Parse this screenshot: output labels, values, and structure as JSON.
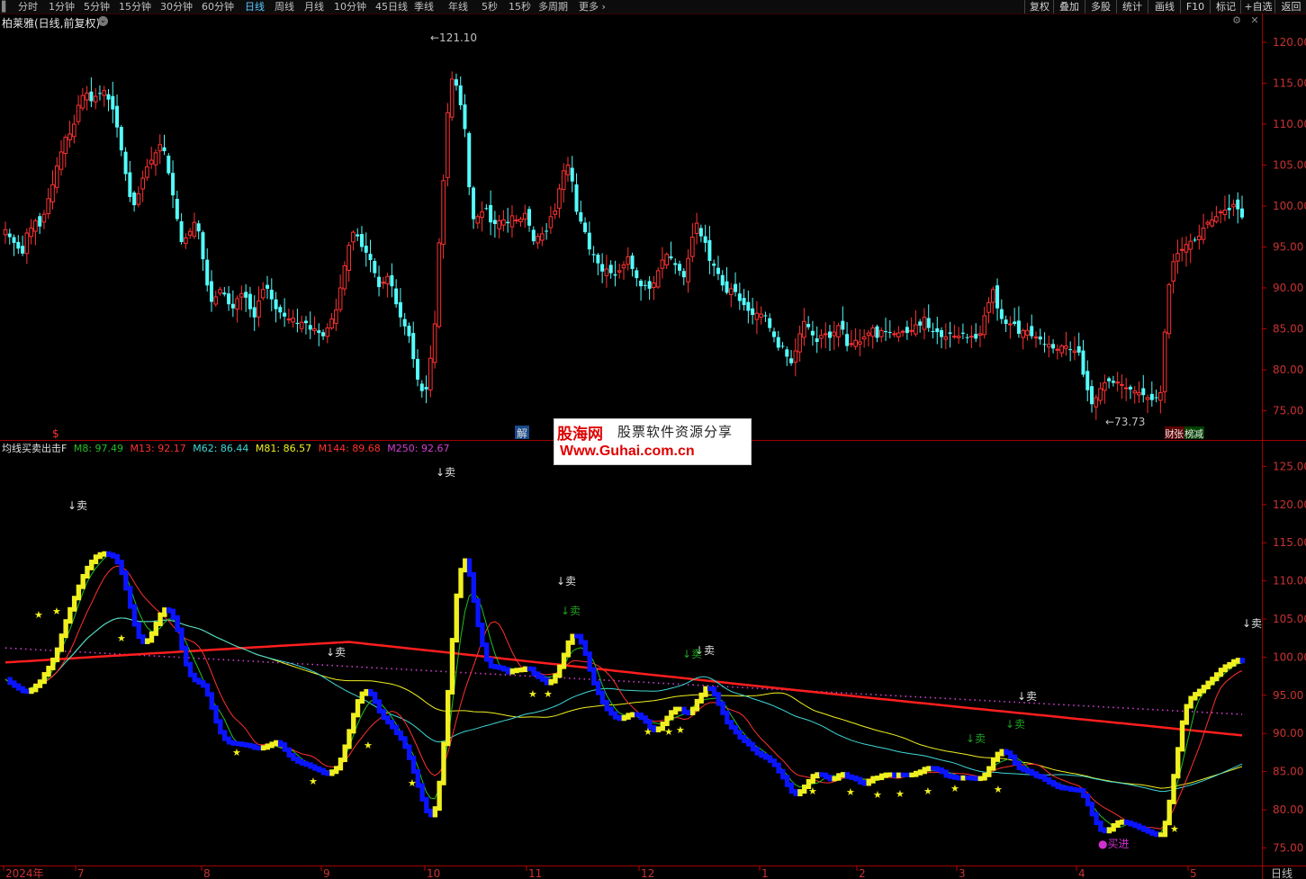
{
  "toolbar": {
    "periods": [
      "分时",
      "1分钟",
      "5分钟",
      "15分钟",
      "30分钟",
      "60分钟",
      "日线",
      "周线",
      "月线",
      "10分钟",
      "45日线",
      "季线",
      "年线",
      "5秒",
      "15秒",
      "多周期",
      "更多"
    ],
    "active": "日线",
    "right_buttons": [
      "复权",
      "叠加",
      "多股",
      "统计",
      "画线",
      "F10",
      "标记",
      "+自选",
      "返回"
    ]
  },
  "stock": {
    "title": "柏莱雅(日线,前复权)"
  },
  "watermark": {
    "brand": "股海网",
    "tagline": "股票软件资源分享",
    "url": "Www.Guhai.com.cn"
  },
  "colors": {
    "up": "#ff3232",
    "down": "#54fcfc",
    "bg": "#000000",
    "axis": "#c00000"
  },
  "chart_data": [
    {
      "type": "candlestick",
      "title": "",
      "ylim": [
        73,
        122
      ],
      "y_ticks": [
        75,
        80,
        85,
        90,
        95,
        100,
        105,
        110,
        115,
        120
      ],
      "annotations": {
        "high": "121.10",
        "low": "73.73"
      },
      "markers": {
        "left": "$",
        "mid": "解",
        "right_a": "财",
        "right_b": "张",
        "right_c": "榜",
        "right_d": "减"
      },
      "closes": [
        97.1,
        96.2,
        95.5,
        94.8,
        94.2,
        96.7,
        97.3,
        98.2,
        97.5,
        99,
        100.9,
        102.6,
        104.9,
        106.6,
        108.4,
        108.8,
        110,
        112.3,
        113.5,
        113.8,
        112.8,
        113.4,
        113.8,
        114.1,
        113,
        111.8,
        109.6,
        106.8,
        103.9,
        101.1,
        100.1,
        101.5,
        103.4,
        104.8,
        105.6,
        106.5,
        107.5,
        106.7,
        104,
        101.3,
        98.4,
        95.6,
        96.1,
        96.9,
        98,
        96.9,
        93.5,
        90.3,
        88.3,
        88.9,
        89.8,
        89.2,
        88,
        87.5,
        88.7,
        89.3,
        88.8,
        87.4,
        86.4,
        88.4,
        89.8,
        89.9,
        88.6,
        87.4,
        87,
        86.5,
        86.2,
        86.3,
        85.6,
        85.8,
        85.7,
        84.9,
        85,
        84.5,
        84.1,
        85.1,
        86.2,
        87.3,
        90,
        92.7,
        95.2,
        96.8,
        96.3,
        95,
        94.3,
        93.4,
        91.8,
        90.1,
        90.7,
        91.4,
        90.2,
        88,
        86.4,
        85.3,
        84.1,
        81.3,
        78.8,
        77.4,
        77.6,
        81.4,
        85.6,
        95.5,
        103.1,
        111.4,
        115.5,
        114.7,
        112.3,
        109.4,
        102.3,
        98.4,
        98.7,
        99.3,
        99.7,
        98,
        97.8,
        98.2,
        98.3,
        97.9,
        98.8,
        98.3,
        98.4,
        99.1,
        97.6,
        95.7,
        96.3,
        96.6,
        96.9,
        98.7,
        99.4,
        102.1,
        104.3,
        105,
        103,
        99.3,
        98.1,
        96.8,
        94.7,
        94,
        93,
        92,
        92.3,
        91.8,
        91.5,
        92.1,
        92.8,
        93.8,
        92.3,
        91.2,
        90.2,
        90.3,
        89.9,
        90.6,
        92.1,
        93.4,
        94.1,
        93.6,
        92.8,
        92.1,
        91.3,
        93.6,
        96.2,
        97.9,
        96.3,
        95.5,
        93.3,
        92.7,
        91.7,
        90.3,
        89.4,
        89.9,
        89.5,
        88.4,
        87.9,
        87.2,
        86.7,
        86.9,
        86.8,
        86.6,
        85.1,
        84,
        82.7,
        82.9,
        81.6,
        80.8,
        82.3,
        84.4,
        85.9,
        85.2,
        84.2,
        83.4,
        84.2,
        84.4,
        83.9,
        84.6,
        85.4,
        84.9,
        82.9,
        83.2,
        83.6,
        83.4,
        84,
        84.5,
        85.1,
        83.9,
        84.8,
        84.6,
        84.6,
        84.4,
        84.5,
        84.7,
        84.5,
        84.8,
        85.5,
        85.4,
        86.4,
        85.1,
        84.7,
        84.6,
        84,
        84,
        84.4,
        84.1,
        84.1,
        84.4,
        83.9,
        84.1,
        83.8,
        84.4,
        86.6,
        88.2,
        89.8,
        87.5,
        86.2,
        85.6,
        85.6,
        85.6,
        84.4,
        84.8,
        84.8,
        84.1,
        84,
        83.7,
        83.1,
        83.1,
        82.6,
        82.5,
        82.9,
        82.9,
        82.4,
        82.3,
        82.1,
        79.4,
        77.5,
        75.8,
        76.6,
        77.7,
        78.4,
        78.6,
        78.4,
        78.5,
        78.2,
        77.8,
        77.6,
        77.4,
        77.2,
        76.9,
        76.6,
        76.3,
        76.6,
        77.2,
        84.6,
        90.4,
        93.2,
        94.2,
        94.7,
        95.3,
        95.7,
        95.8,
        96.3,
        97.3,
        98,
        98.3,
        98.7,
        99.3,
        99.5,
        99.5,
        100.2,
        99.6,
        98.6
      ]
    },
    {
      "type": "line",
      "title": "均线买卖出击F",
      "ylim": [
        73,
        128
      ],
      "y_ticks": [
        75,
        80,
        85,
        90,
        95,
        100,
        105,
        110,
        115,
        120,
        125
      ],
      "series": [
        {
          "name": "M8",
          "label": "M8: 97.49",
          "color": "#22c022"
        },
        {
          "name": "M13",
          "label": "M13: 92.17",
          "color": "#ff3030"
        },
        {
          "name": "M62",
          "label": "M62: 86.44",
          "color": "#40d8d8"
        },
        {
          "name": "M81",
          "label": "M81: 86.57",
          "color": "#f0f020"
        },
        {
          "name": "M144",
          "label": "M144: 89.68",
          "color": "#ff2020"
        },
        {
          "name": "M250",
          "label": "M250: 92.67",
          "color": "#d040d0"
        }
      ],
      "signal_labels": {
        "sell": "↓卖",
        "buy": "●买进",
        "star": "★"
      }
    }
  ],
  "x_axis": {
    "labels": [
      "2024年",
      "7",
      "8",
      "9",
      "10",
      "11",
      "12",
      "1",
      "2",
      "3",
      "4",
      "5"
    ],
    "period_label": "日线"
  }
}
